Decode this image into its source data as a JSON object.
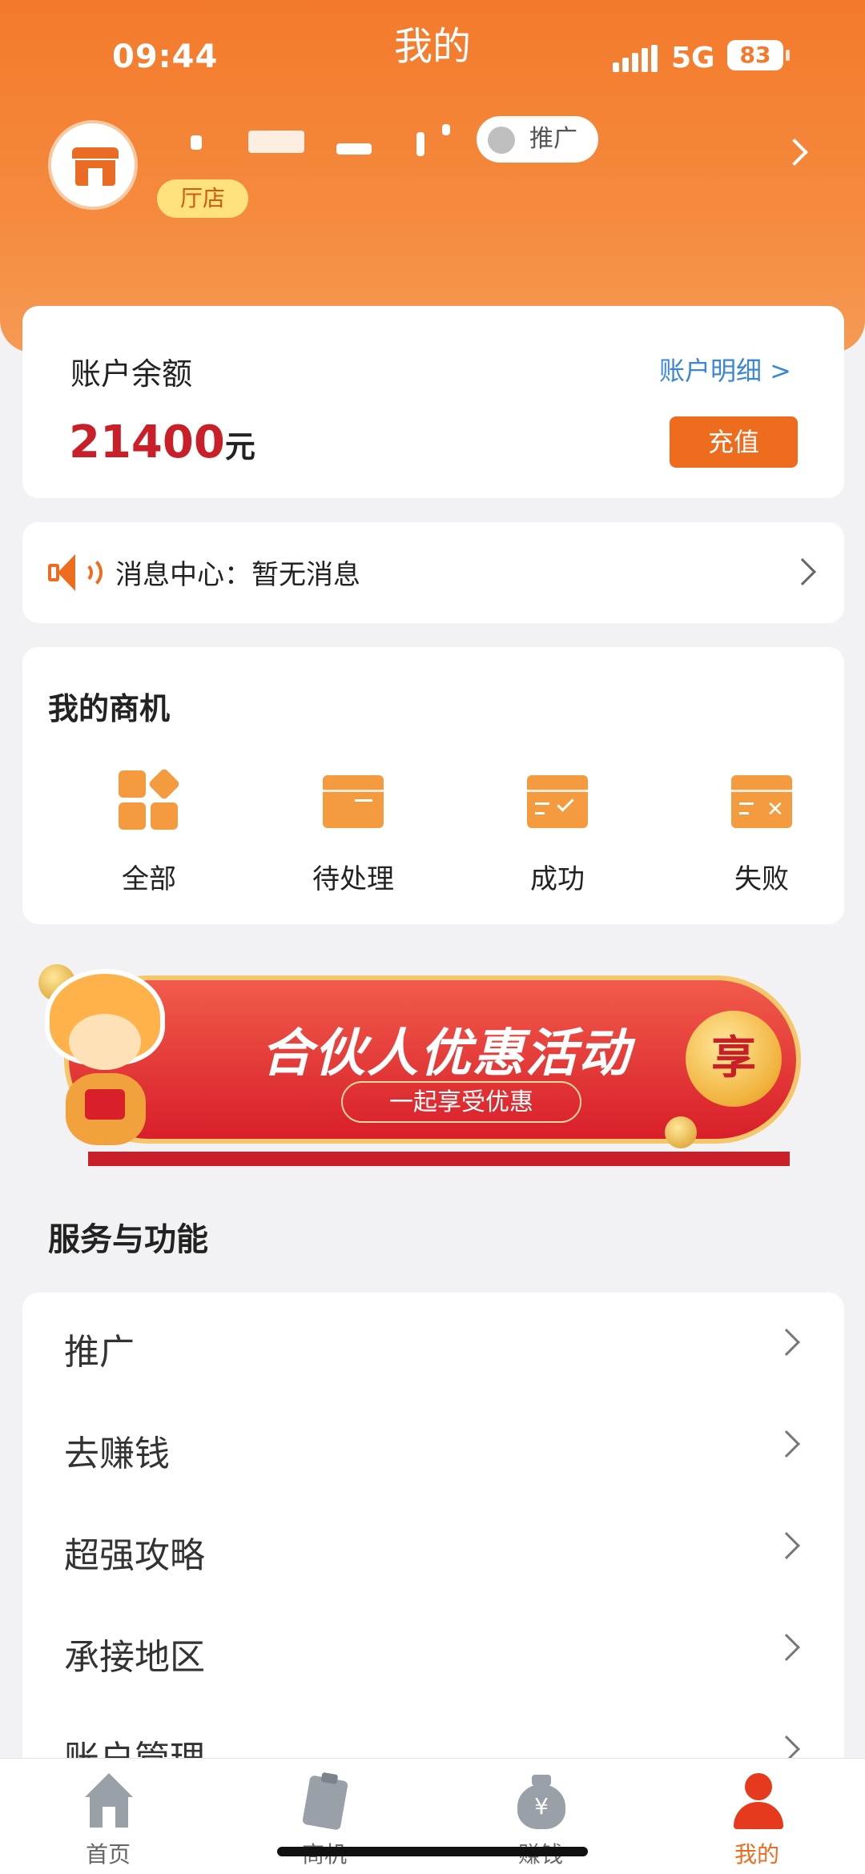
{
  "status_bar": {
    "time": "09:44",
    "network": "5G",
    "battery": "83"
  },
  "page_title": "我的",
  "profile": {
    "promo_pill": "推广",
    "store_tag": "厅店"
  },
  "balance": {
    "label": "账户余额",
    "detail_link": "账户明细 >",
    "amount": "21400",
    "unit": "元",
    "recharge_button": "充值"
  },
  "message": {
    "text": "消息中心：暂无消息"
  },
  "business": {
    "title": "我的商机",
    "items": [
      {
        "label": "全部",
        "icon": "grid-icon"
      },
      {
        "label": "待处理",
        "icon": "box-icon"
      },
      {
        "label": "成功",
        "icon": "box-check-icon"
      },
      {
        "label": "失败",
        "icon": "box-x-icon"
      }
    ]
  },
  "banner": {
    "headline": "合伙人优惠活动",
    "subline": "一起享受优惠",
    "badge": "享"
  },
  "services": {
    "title": "服务与功能",
    "items": [
      {
        "label": "推广"
      },
      {
        "label": "去赚钱"
      },
      {
        "label": "超强攻略"
      },
      {
        "label": "承接地区"
      },
      {
        "label": "账户管理"
      }
    ]
  },
  "tabbar": {
    "items": [
      {
        "label": "首页",
        "icon": "home-icon"
      },
      {
        "label": "商机",
        "icon": "clipboard-icon"
      },
      {
        "label": "赚钱",
        "icon": "money-bag-icon"
      },
      {
        "label": "我的",
        "icon": "person-icon",
        "active": true
      }
    ]
  },
  "colors": {
    "accent": "#ee6c1e",
    "header": "#f37a2c",
    "amount": "#c81f28",
    "link": "#3a86d8"
  }
}
